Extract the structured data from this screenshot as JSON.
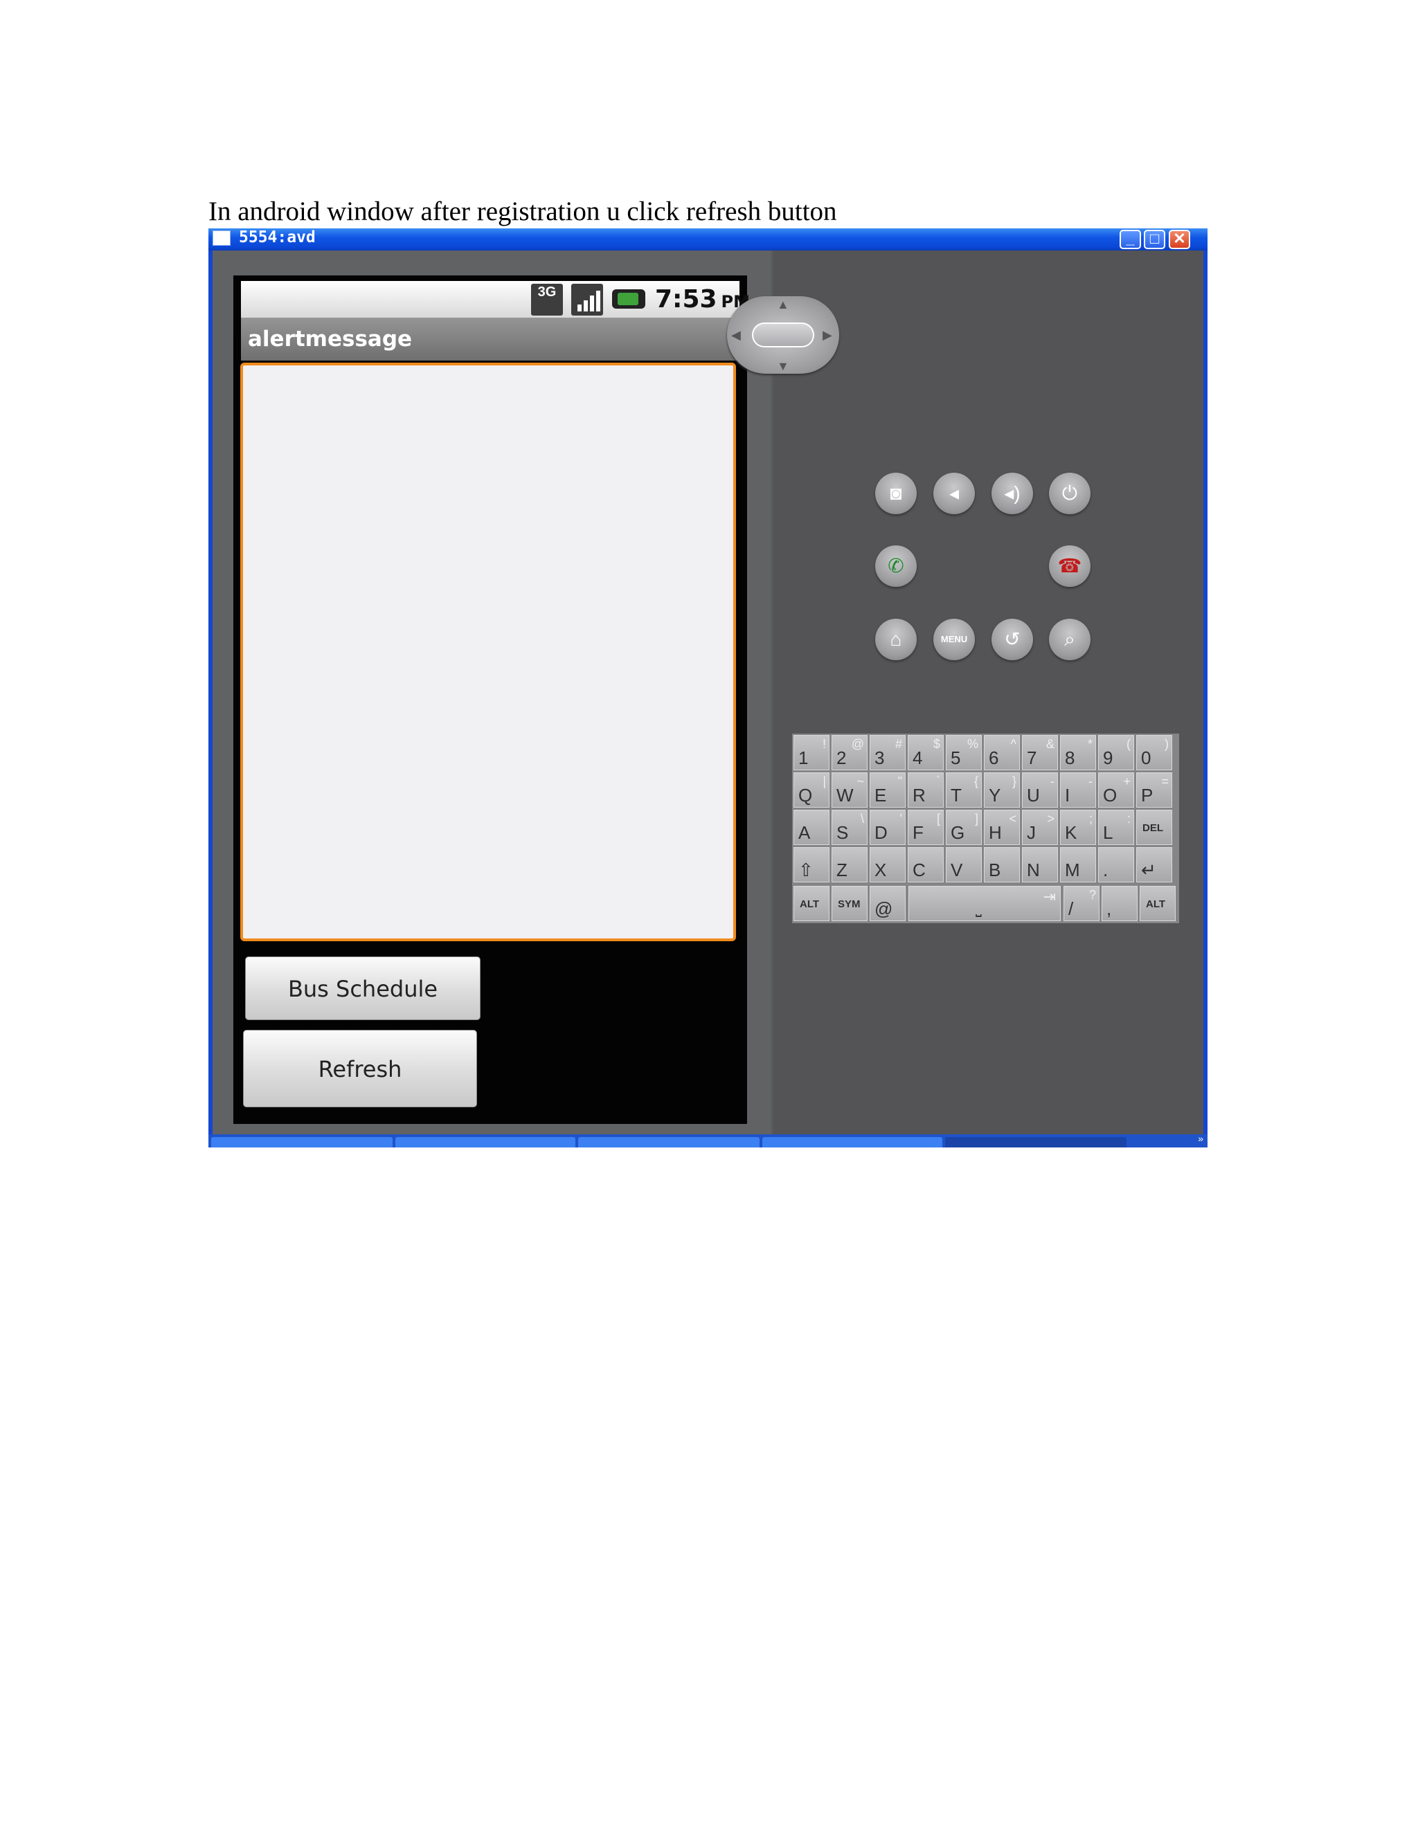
{
  "caption": "In android window after registration u click refresh button",
  "window": {
    "title": "5554:avd",
    "buttons": {
      "minimize": "_",
      "maximize": "□",
      "close": "✕"
    }
  },
  "phone": {
    "status": {
      "network": "3G",
      "time": "7:53",
      "ampm": "PM"
    },
    "app_title": "alertmessage",
    "message_value": "",
    "buttons": {
      "bus_schedule": "Bus Schedule",
      "refresh": "Refresh"
    }
  },
  "controls": {
    "row1": [
      "camera-icon",
      "volume-down-icon",
      "volume-up-icon",
      "power-icon"
    ],
    "row2": [
      "call-icon",
      "dpad",
      "end-call-icon"
    ],
    "row3": [
      "home-icon",
      "menu-button",
      "back-icon",
      "search-icon"
    ],
    "menu_label": "MENU"
  },
  "keyboard": {
    "rows": [
      [
        [
          "1",
          "!"
        ],
        [
          "2",
          "@"
        ],
        [
          "3",
          "#"
        ],
        [
          "4",
          "$"
        ],
        [
          "5",
          "%"
        ],
        [
          "6",
          "^"
        ],
        [
          "7",
          "&"
        ],
        [
          "8",
          "*"
        ],
        [
          "9",
          "("
        ],
        [
          "0",
          ")"
        ]
      ],
      [
        [
          "Q",
          "|"
        ],
        [
          "W",
          "~"
        ],
        [
          "E",
          "\""
        ],
        [
          "R",
          "`"
        ],
        [
          "T",
          "{"
        ],
        [
          "Y",
          "}"
        ],
        [
          "U",
          "-"
        ],
        [
          "I",
          "-"
        ],
        [
          "O",
          "+"
        ],
        [
          "P",
          "="
        ]
      ],
      [
        [
          "A",
          ""
        ],
        [
          "S",
          "\\"
        ],
        [
          "D",
          "'"
        ],
        [
          "F",
          "["
        ],
        [
          "G",
          "]"
        ],
        [
          "H",
          "<"
        ],
        [
          "J",
          ">"
        ],
        [
          "K",
          ";"
        ],
        [
          "L",
          ":"
        ],
        [
          "DEL",
          ""
        ]
      ],
      [
        [
          "⇧",
          ""
        ],
        [
          "Z",
          ""
        ],
        [
          "X",
          ""
        ],
        [
          "C",
          ""
        ],
        [
          "V",
          ""
        ],
        [
          "B",
          ""
        ],
        [
          "N",
          ""
        ],
        [
          "M",
          ""
        ],
        [
          ".",
          ""
        ],
        [
          "↵",
          ""
        ]
      ]
    ],
    "bottom": {
      "alt_left": "ALT",
      "sym": "SYM",
      "at": "@",
      "space": "⎵",
      "tab": "⇥",
      "slash": "/",
      "question": "?",
      "comma": ",",
      "alt_right": "ALT"
    }
  },
  "taskbar": {
    "overflow": "»"
  }
}
